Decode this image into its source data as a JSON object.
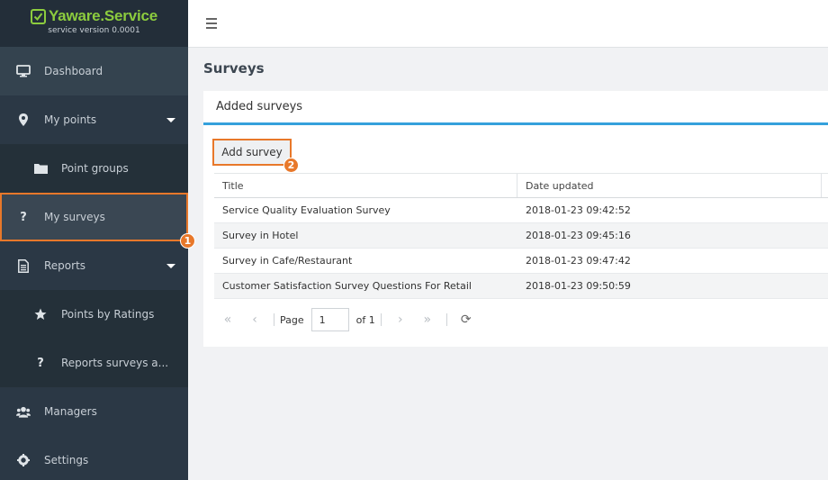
{
  "brand": {
    "name": "Yaware.Service",
    "version": "service version 0.0001"
  },
  "sidebar": {
    "items": [
      {
        "label": "Dashboard",
        "icon": "monitor-icon"
      },
      {
        "label": "My points",
        "icon": "map-pin-icon"
      },
      {
        "label": "Point groups",
        "icon": "folder-icon"
      },
      {
        "label": "My surveys",
        "icon": "question-icon"
      },
      {
        "label": "Reports",
        "icon": "document-icon"
      },
      {
        "label": "Points by Ratings",
        "icon": "star-icon"
      },
      {
        "label": "Reports surveys a...",
        "icon": "question-icon"
      },
      {
        "label": "Managers",
        "icon": "users-icon"
      },
      {
        "label": "Settings",
        "icon": "gear-icon"
      }
    ]
  },
  "badges": {
    "one": "1",
    "two": "2"
  },
  "page": {
    "title": "Surveys"
  },
  "panel": {
    "title": "Added surveys",
    "add_label": "Add survey"
  },
  "table": {
    "headers": [
      "Title",
      "Date updated"
    ],
    "rows": [
      [
        "Service Quality Evaluation Survey",
        "2018-01-23 09:42:52"
      ],
      [
        "Survey in Hotel",
        "2018-01-23 09:45:16"
      ],
      [
        "Survey in Cafe/Restaurant",
        "2018-01-23 09:47:42"
      ],
      [
        "Customer Satisfaction Survey Questions For Retail",
        "2018-01-23 09:50:59"
      ]
    ]
  },
  "pager": {
    "page_label": "Page",
    "current": "1",
    "of_label": "of 1"
  },
  "colors": {
    "accent_blue": "#35a1dc",
    "highlight_orange": "#e8782a",
    "brand_green": "#8ccc3e",
    "sidebar_bg": "#2b3845"
  }
}
